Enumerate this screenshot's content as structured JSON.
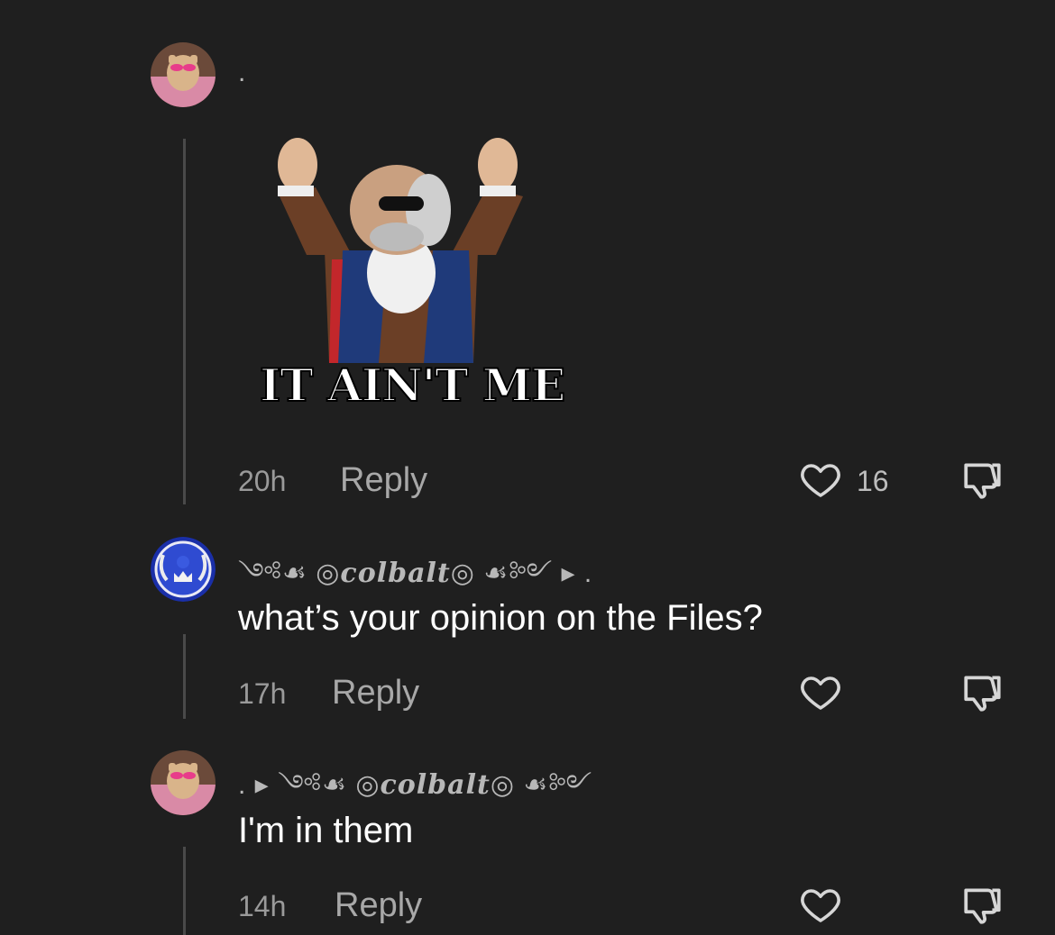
{
  "comments": [
    {
      "username": ".",
      "time": "20h",
      "reply_label": "Reply",
      "likes": "16",
      "sticker_caption": "IT AIN'T ME"
    },
    {
      "username_prefix": "༺☙",
      "username": "◎colbalt◎",
      "username_suffix": "☙༻ ▸ .",
      "text": "what’s your opinion on the Files?",
      "time": "17h",
      "reply_label": "Reply"
    },
    {
      "username_prefix": ". ▸ ༺☙",
      "username": "◎colbalt◎",
      "username_suffix": "☙༻",
      "text": "I'm in them",
      "time": "14h",
      "reply_label": "Reply"
    }
  ],
  "colors": {
    "background": "#1f1f1f",
    "secondary_text": "#a8a8a8",
    "avatar2_blue": "#2f4bd1"
  }
}
